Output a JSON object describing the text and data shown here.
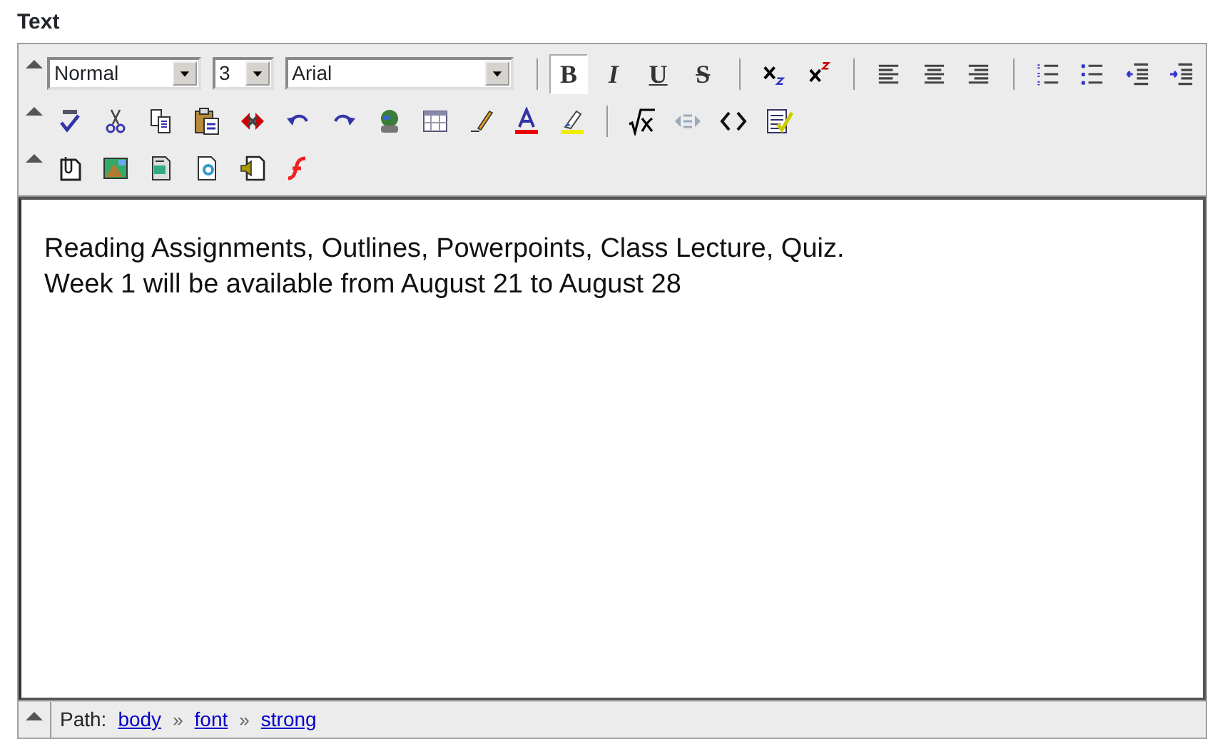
{
  "field_label": "Text",
  "toolbar": {
    "format": {
      "value": "Normal"
    },
    "size": {
      "value": "3"
    },
    "font": {
      "value": "Arial"
    },
    "styles": [
      {
        "label": "B",
        "kind": "bold",
        "selected": true
      },
      {
        "label": "I",
        "kind": "italic",
        "selected": false
      },
      {
        "label": "U",
        "kind": "underline",
        "selected": false
      },
      {
        "label": "S",
        "kind": "strike",
        "selected": false
      }
    ]
  },
  "content": {
    "lines": [
      "Reading Assignments, Outlines, Powerpoints, Class Lecture, Quiz.",
      "Week 1 will be available from August 21 to August 28"
    ]
  },
  "path": {
    "label": "Path:",
    "items": [
      "body",
      "font",
      "strong"
    ],
    "separators": [
      "»",
      "»"
    ]
  }
}
